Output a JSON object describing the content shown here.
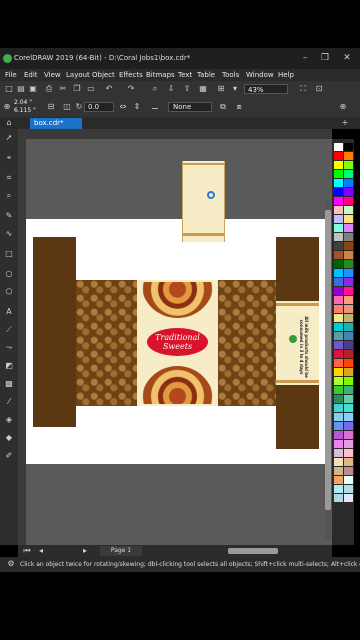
{
  "app": {
    "title": "CorelDRAW 2019 (64-Bit) - D:\\Coral Jobs1\\box.cdr*",
    "window_controls": [
      "–",
      "❐",
      "✕"
    ]
  },
  "menu": [
    "File",
    "Edit",
    "View",
    "Layout",
    "Object",
    "Effects",
    "Bitmaps",
    "Text",
    "Table",
    "Tools",
    "Window",
    "Help"
  ],
  "toolbar": {
    "zoom": "43%"
  },
  "property_bar": {
    "x": "2.04 \"",
    "y": "6.115 \"",
    "rotation": "0.0",
    "outline": "None"
  },
  "document_tab": {
    "label": "box.cdr*"
  },
  "page_navigator": {
    "label": "Page 1"
  },
  "status": {
    "hint": "Click an object twice for rotating/skewing; dbl-clicking tool selects all objects; Shift+click multi-selects; Alt+click digs; Ctrl+click"
  },
  "artwork": {
    "brand_line1": "Traditional",
    "brand_line2": "Sweets",
    "side_text": "All milk products should be consumed in 3 to 4 days"
  },
  "palette_colors": [
    "#ffffff",
    "#000000",
    "#ff0000",
    "#ff7f00",
    "#ffff00",
    "#7fff00",
    "#00ff00",
    "#00ff7f",
    "#00ffff",
    "#007fff",
    "#0000ff",
    "#7f00ff",
    "#ff00ff",
    "#ff007f",
    "#ffbfbf",
    "#bfffbf",
    "#bfbfff",
    "#ffdf80",
    "#80ffdf",
    "#df80ff",
    "#c0c0c0",
    "#808080",
    "#404040",
    "#8b4513",
    "#a0522d",
    "#cd853f",
    "#006400",
    "#228b22",
    "#00bfff",
    "#1e90ff",
    "#4169e1",
    "#8a2be2",
    "#9400d3",
    "#ff1493",
    "#ff69b4",
    "#ffa07a",
    "#fa8072",
    "#e9967a",
    "#f0e68c",
    "#bdb76b",
    "#00ced1",
    "#20b2aa",
    "#5f9ea0",
    "#4682b4",
    "#6a5acd",
    "#483d8b",
    "#dc143c",
    "#b22222",
    "#ff6347",
    "#ff4500",
    "#ffd700",
    "#daa520",
    "#adff2f",
    "#7cfc00",
    "#32cd32",
    "#3cb371",
    "#2e8b57",
    "#66cdaa",
    "#48d1cc",
    "#40e0d0",
    "#87ceeb",
    "#87cefa",
    "#6495ed",
    "#7b68ee",
    "#ba55d3",
    "#da70d6",
    "#ee82ee",
    "#dda0dd",
    "#d8bfd8",
    "#ffc0cb",
    "#f5deb3",
    "#deb887",
    "#d2b48c",
    "#bc8f8f",
    "#f4a460",
    "#e0ffff",
    "#afeeee",
    "#b0e0e6",
    "#add8e6",
    "#e6e6fa"
  ]
}
